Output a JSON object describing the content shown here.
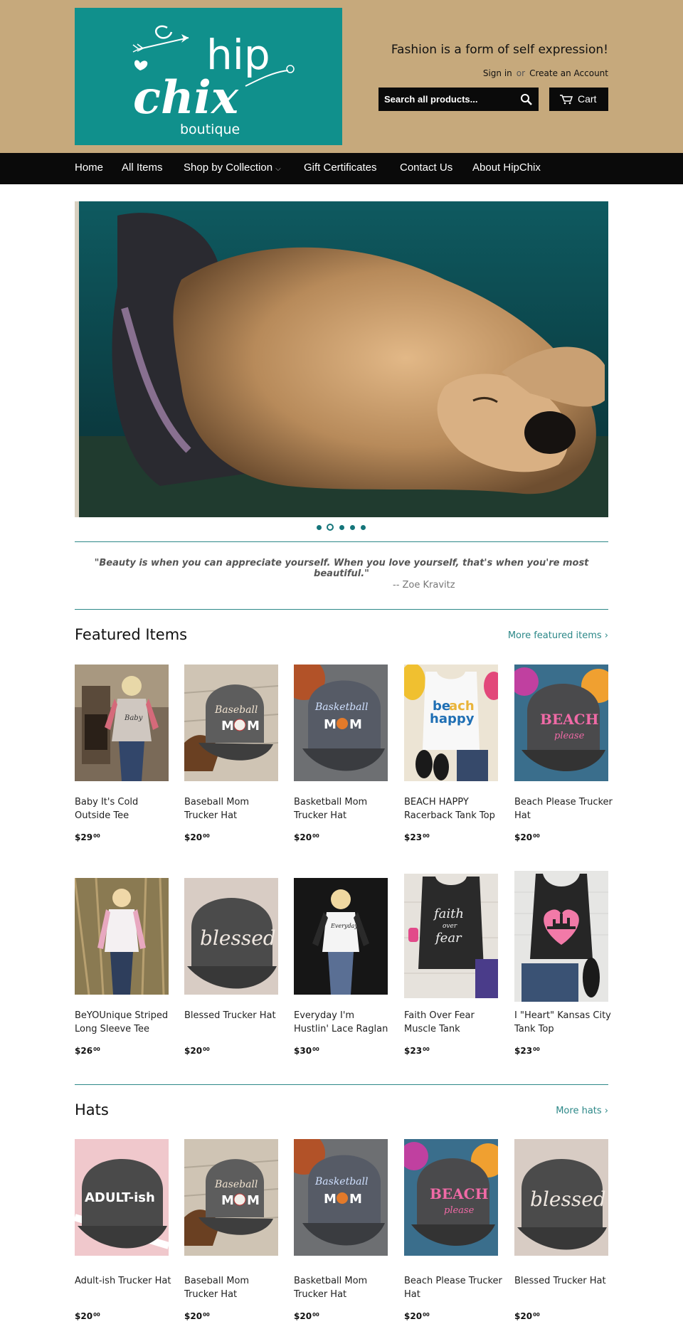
{
  "header": {
    "logo": {
      "name": "hip chix",
      "sub": "boutique"
    },
    "tagline": "Fashion is a form of self expression!",
    "sign_in": "Sign in",
    "or": "or",
    "create_account": "Create an Account",
    "search_placeholder": "Search all products...",
    "cart_label": "Cart"
  },
  "nav": {
    "items": [
      {
        "label": "Home"
      },
      {
        "label": "All Items"
      },
      {
        "label": "Shop by Collection"
      },
      {
        "label": "Gift Certificates"
      },
      {
        "label": "Contact Us"
      },
      {
        "label": "About HipChix"
      }
    ]
  },
  "slider": {
    "count": 5,
    "active_index": 1
  },
  "quote": {
    "text": "\"Beauty is when you can appreciate yourself.  When you love yourself, that's when you're most beautiful.\"",
    "author": "-- Zoe Kravitz"
  },
  "featured": {
    "title": "Featured Items",
    "more": "More featured items ›",
    "products": [
      {
        "title": "Baby It's Cold Outside Tee",
        "price": "$29",
        "cents": "00",
        "icon": "woman-tee-photo"
      },
      {
        "title": "Baseball Mom Trucker Hat",
        "price": "$20",
        "cents": "00",
        "icon": "baseball-mom-hat-photo"
      },
      {
        "title": "Basketball Mom Trucker Hat",
        "price": "$20",
        "cents": "00",
        "icon": "basketball-mom-hat-photo"
      },
      {
        "title": "BEACH HAPPY Racerback Tank Top",
        "price": "$23",
        "cents": "00",
        "icon": "beach-happy-tank-photo"
      },
      {
        "title": "Beach Please Trucker Hat",
        "price": "$20",
        "cents": "00",
        "icon": "beach-please-hat-photo"
      },
      {
        "title": "BeYOUnique Striped Long Sleeve Tee",
        "price": "$26",
        "cents": "00",
        "icon": "woman-striped-tee-photo"
      },
      {
        "title": "Blessed Trucker Hat",
        "price": "$20",
        "cents": "00",
        "icon": "blessed-hat-photo"
      },
      {
        "title": "Everyday I'm Hustlin' Lace Raglan",
        "price": "$30",
        "cents": "00",
        "icon": "woman-raglan-photo"
      },
      {
        "title": "Faith Over Fear Muscle Tank",
        "price": "$23",
        "cents": "00",
        "icon": "faith-tank-photo"
      },
      {
        "title": "I \"Heart\" Kansas City Tank Top",
        "price": "$23",
        "cents": "00",
        "icon": "kansas-city-tank-photo"
      }
    ]
  },
  "hats": {
    "title": "Hats",
    "more": "More hats ›",
    "products": [
      {
        "title": "Adult-ish Trucker Hat",
        "price": "$20",
        "cents": "00",
        "icon": "adultish-hat-photo"
      },
      {
        "title": "Baseball Mom Trucker Hat",
        "price": "$20",
        "cents": "00",
        "icon": "baseball-mom-hat-photo"
      },
      {
        "title": "Basketball Mom Trucker Hat",
        "price": "$20",
        "cents": "00",
        "icon": "basketball-mom-hat-photo"
      },
      {
        "title": "Beach Please Trucker Hat",
        "price": "$20",
        "cents": "00",
        "icon": "beach-please-hat-photo"
      },
      {
        "title": "Blessed Trucker Hat",
        "price": "$20",
        "cents": "00",
        "icon": "blessed-hat-photo"
      }
    ]
  },
  "colors": {
    "header_bg": "#c6a97c",
    "logo_bg": "#10908c",
    "nav_bg": "#0a0a0a",
    "accent": "#2c8888"
  }
}
